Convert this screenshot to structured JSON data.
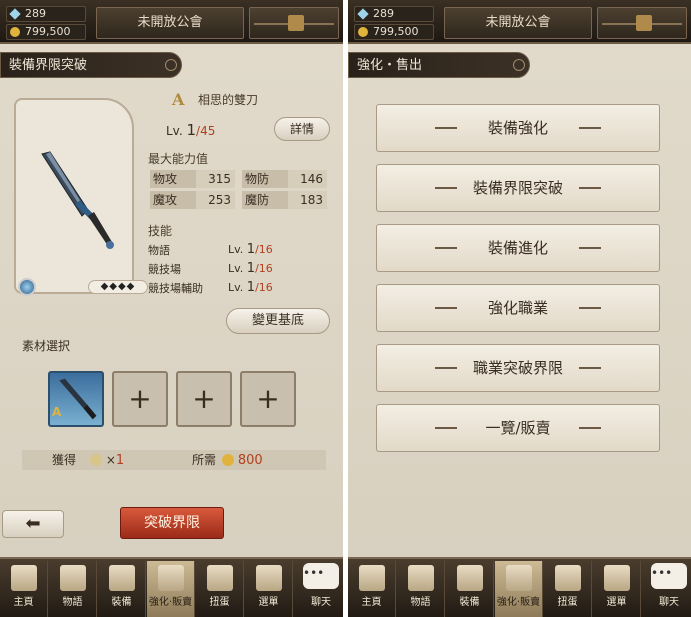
{
  "left": {
    "topbar": {
      "gems": "289",
      "gold": "799,500",
      "guild": "未開放公會"
    },
    "section_title": "裝備界限突破",
    "weapon": {
      "grade": "A",
      "name": "相思的雙刀",
      "level_prefix": "Lv.",
      "level": "1",
      "level_max": "/45",
      "rarity": "◆◆◆◆",
      "detail_button": "詳情"
    },
    "stats": {
      "title": "最大能力值",
      "rows": [
        {
          "k1": "物攻",
          "v1": "315",
          "k2": "物防",
          "v2": "146"
        },
        {
          "k1": "魔攻",
          "v1": "253",
          "k2": "魔防",
          "v2": "183"
        }
      ]
    },
    "skills": {
      "title": "技能",
      "rows": [
        {
          "name": "物語",
          "lv": "Lv.",
          "cur": "1",
          "max": "/16"
        },
        {
          "name": "競技場",
          "lv": "Lv.",
          "cur": "1",
          "max": "/16"
        },
        {
          "name": "競技場輔助",
          "lv": "Lv.",
          "cur": "1",
          "max": "/16"
        }
      ]
    },
    "change_base_button": "變更基底",
    "materials": {
      "title": "素材選択",
      "grade": "A",
      "plus": "+"
    },
    "gain": {
      "label": "獲得",
      "times": "×",
      "count": "1",
      "cost_label": "所需",
      "cost": "800"
    },
    "back_icon": "back-arrow-icon",
    "break_button": "突破界限"
  },
  "right": {
    "topbar": {
      "gems": "289",
      "gold": "799,500",
      "guild": "未開放公會"
    },
    "section_title": "強化・售出",
    "menu": [
      "裝備強化",
      "裝備界限突破",
      "裝備進化",
      "強化職業",
      "職業突破界限",
      "一覽/販賣"
    ]
  },
  "nav": [
    {
      "label": "主頁",
      "icon": "castle-icon"
    },
    {
      "label": "物語",
      "icon": "book-icon"
    },
    {
      "label": "裝備",
      "icon": "armor-icon"
    },
    {
      "label": "強化‧販賣",
      "icon": "anvil-icon"
    },
    {
      "label": "扭蛋",
      "icon": "sword-icon"
    },
    {
      "label": "選單",
      "icon": "gear-icon"
    }
  ],
  "chat": {
    "label": "聊天",
    "bubble": "•••"
  }
}
